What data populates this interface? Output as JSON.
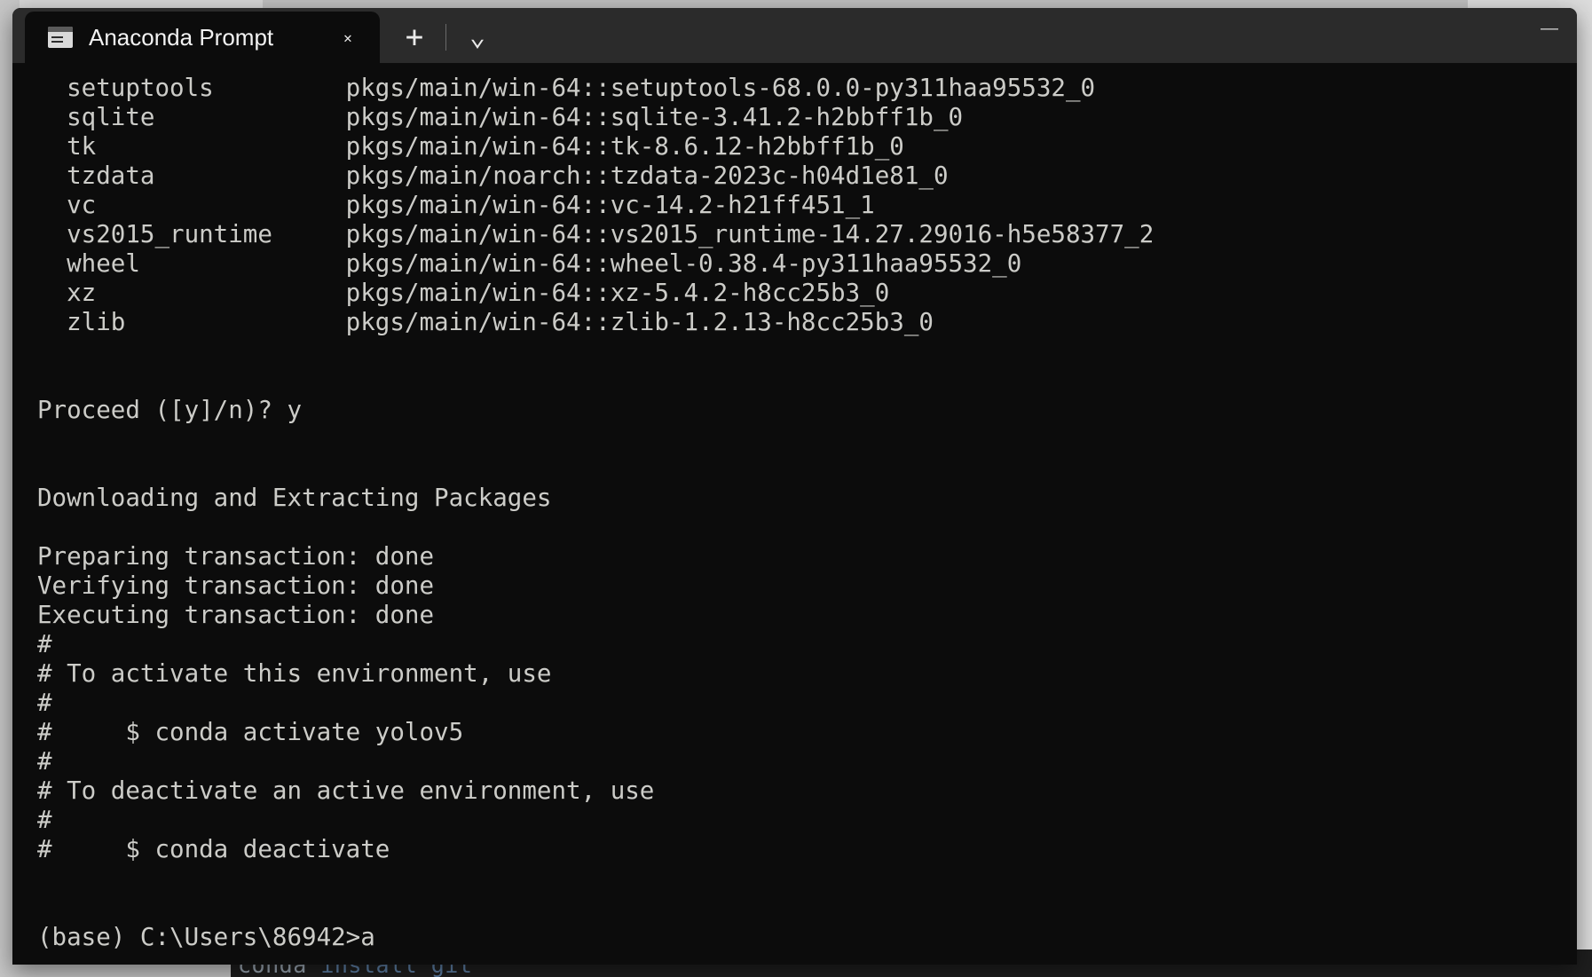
{
  "window": {
    "title": "Anaconda Prompt",
    "tab_icon": "console-icon",
    "close_label": "✕",
    "new_tab_label": "+",
    "dropdown_label": "⌄",
    "minimize_label": "—",
    "maximize_label": "□",
    "app_close_label": "✕",
    "background_color": "#0c0c0c",
    "titlebar_color": "#2b2b2b",
    "text_color": "#ccccc8"
  },
  "background": {
    "editor_line_prefix": "conda ",
    "editor_line_arg": "install git"
  },
  "console": {
    "lines": [
      "  setuptools         pkgs/main/win-64::setuptools-68.0.0-py311haa95532_0",
      "  sqlite             pkgs/main/win-64::sqlite-3.41.2-h2bbff1b_0",
      "  tk                 pkgs/main/win-64::tk-8.6.12-h2bbff1b_0",
      "  tzdata             pkgs/main/noarch::tzdata-2023c-h04d1e81_0",
      "  vc                 pkgs/main/win-64::vc-14.2-h21ff451_1",
      "  vs2015_runtime     pkgs/main/win-64::vs2015_runtime-14.27.29016-h5e58377_2",
      "  wheel              pkgs/main/win-64::wheel-0.38.4-py311haa95532_0",
      "  xz                 pkgs/main/win-64::xz-5.4.2-h8cc25b3_0",
      "  zlib               pkgs/main/win-64::zlib-1.2.13-h8cc25b3_0",
      "",
      "",
      "Proceed ([y]/n)? y",
      "",
      "",
      "Downloading and Extracting Packages",
      "",
      "Preparing transaction: done",
      "Verifying transaction: done",
      "Executing transaction: done",
      "#",
      "# To activate this environment, use",
      "#",
      "#     $ conda activate yolov5",
      "#",
      "# To deactivate an active environment, use",
      "#",
      "#     $ conda deactivate",
      "",
      "",
      "(base) C:\\Users\\86942>a"
    ]
  }
}
